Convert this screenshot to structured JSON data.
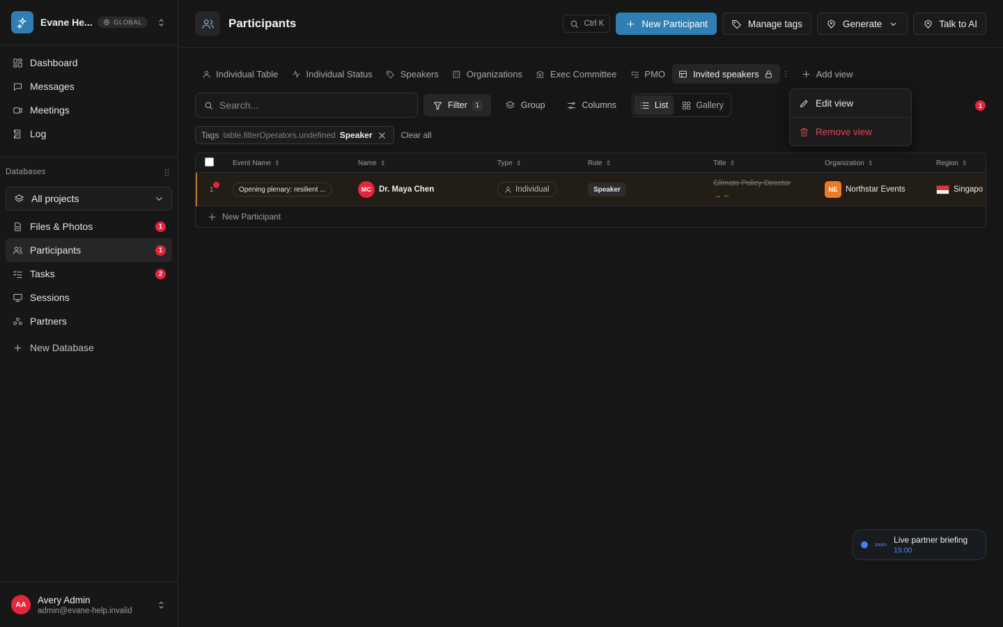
{
  "workspace": {
    "name": "Evane He...",
    "badge": "GLOBAL"
  },
  "nav": [
    {
      "label": "Dashboard",
      "icon": "dashboard-icon"
    },
    {
      "label": "Messages",
      "icon": "message-icon"
    },
    {
      "label": "Meetings",
      "icon": "video-icon"
    },
    {
      "label": "Log",
      "icon": "log-icon"
    }
  ],
  "databases": {
    "heading": "Databases",
    "selector": "All projects",
    "items": [
      {
        "label": "Files & Photos",
        "count": "1"
      },
      {
        "label": "Participants",
        "count": "1"
      },
      {
        "label": "Tasks",
        "count": "2"
      },
      {
        "label": "Sessions",
        "count": ""
      },
      {
        "label": "Partners",
        "count": ""
      }
    ],
    "new_label": "New Database"
  },
  "user": {
    "initials": "AA",
    "name": "Avery Admin",
    "email": "admin@evane-help.invalid"
  },
  "header": {
    "title": "Participants",
    "kbd": "Ctrl K",
    "new_participant": "New Participant",
    "manage_tags": "Manage tags",
    "generate": "Generate",
    "talk_ai": "Talk to AI"
  },
  "views": {
    "tabs": [
      "Individual Table",
      "Individual Status",
      "Speakers",
      "Organizations",
      "Exec Committee",
      "PMO",
      "Invited speakers"
    ],
    "add_view": "Add view"
  },
  "toolbar": {
    "search_placeholder": "Search...",
    "filter": "Filter",
    "filter_count": "1",
    "group": "Group",
    "columns": "Columns",
    "list": "List",
    "gallery": "Gallery",
    "notif_count": "1"
  },
  "chips": {
    "key": "Tags",
    "operator": "table.filterOperators.undefined",
    "value": "Speaker",
    "clear": "Clear all"
  },
  "table": {
    "columns": [
      "Event Name",
      "Name",
      "Type",
      "Role",
      "Title",
      "Organization",
      "Region"
    ],
    "row": {
      "num": "1",
      "event": "Opening plenary: resilient ...",
      "initials": "MC",
      "name": "Dr. Maya Chen",
      "type": "Individual",
      "role": "Speaker",
      "title_old": "Climate Policy Director",
      "title_new": "→ –",
      "org_initials": "NE",
      "org": "Northstar Events",
      "region": "Singapo"
    },
    "new_row": "New Participant"
  },
  "context_menu": {
    "edit": "Edit view",
    "remove": "Remove view"
  },
  "live": {
    "zoom": "zoom",
    "title": "Live partner briefing",
    "time": "15:00"
  },
  "colors": {
    "accent": "#2f7fb3",
    "danger": "#e5253b",
    "orange": "#ec7b21"
  }
}
